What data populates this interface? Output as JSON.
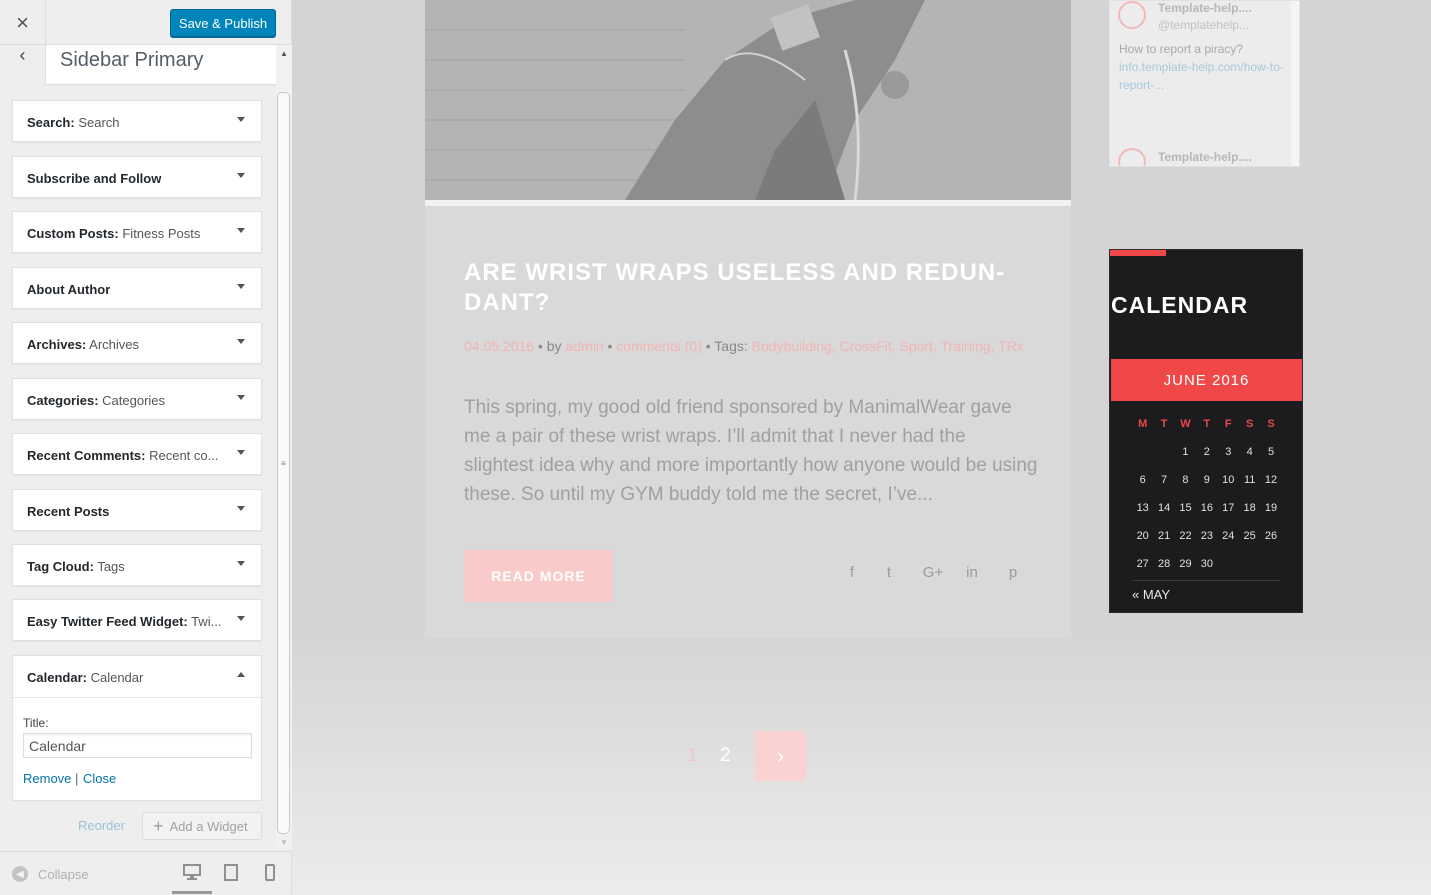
{
  "header": {
    "close_label": "×",
    "save_label": "Save & Publish"
  },
  "section": {
    "back_label": "‹",
    "title": "Sidebar Primary"
  },
  "widgets": [
    {
      "name": "Search:",
      "instance": "Search"
    },
    {
      "name": "Subscribe and Follow",
      "instance": ""
    },
    {
      "name": "Custom Posts:",
      "instance": "Fitness Posts"
    },
    {
      "name": "About Author",
      "instance": ""
    },
    {
      "name": "Archives:",
      "instance": "Archives"
    },
    {
      "name": "Categories:",
      "instance": "Categories"
    },
    {
      "name": "Recent Comments:",
      "instance": "Recent co..."
    },
    {
      "name": "Recent Posts",
      "instance": ""
    },
    {
      "name": "Tag Cloud:",
      "instance": "Tags"
    },
    {
      "name": "Easy Twitter Feed Widget:",
      "instance": "Twi..."
    }
  ],
  "calendar_widget": {
    "name": "Calendar:",
    "instance": "Calendar",
    "title_label": "Title:",
    "title_value": "Calendar",
    "remove_label": "Remove",
    "separator": "|",
    "close_label": "Close"
  },
  "footer_actions": {
    "reorder_label": "Reorder",
    "add_widget_label": "Add a Widget",
    "collapse_label": "Collapse"
  },
  "post": {
    "title": "ARE WRIST WRAPS USELESS AND REDUN-DANT?",
    "date": "04.05.2016",
    "by_label": "by",
    "author": "admin",
    "comments": "comments (0)",
    "tags_label": "Tags:",
    "tags": "Bodybuilding, CrossFit, Sport, Training, TRx",
    "excerpt": "This spring, my good old friend sponsored by ManimalWear gave me a pair of these wrist wraps. I’ll admit that I never had the slightest idea why and more importantly how anyone would be using these. So until my GYM buddy told me the secret, I’ve...",
    "read_more_label": "READ MORE",
    "share_icons": [
      "f",
      "t",
      "G+",
      "in",
      "p"
    ]
  },
  "pagination": {
    "page1": "1",
    "page2": "2",
    "next": "›"
  },
  "twitter": {
    "name": "Template-help....",
    "handle": "@templatehelp...",
    "tweet_text": "How to report a piracy?",
    "tweet_link": "info.template-help.com/how-to-report-...",
    "name2": "Template-help...."
  },
  "calendar": {
    "title": "CALENDAR",
    "month": "JUNE 2016",
    "weekdays": [
      "M",
      "T",
      "W",
      "T",
      "F",
      "S",
      "S"
    ],
    "weeks": [
      [
        "",
        "",
        "1",
        "2",
        "3",
        "4",
        "5"
      ],
      [
        "6",
        "7",
        "8",
        "9",
        "10",
        "11",
        "12"
      ],
      [
        "13",
        "14",
        "15",
        "16",
        "17",
        "18",
        "19"
      ],
      [
        "20",
        "21",
        "22",
        "23",
        "24",
        "25",
        "26"
      ],
      [
        "27",
        "28",
        "29",
        "30",
        "",
        "",
        ""
      ]
    ],
    "prev_label": "« MAY"
  },
  "colors": {
    "accent": "#f04848",
    "primary_button": "#0085ba",
    "link": "#0073aa"
  }
}
